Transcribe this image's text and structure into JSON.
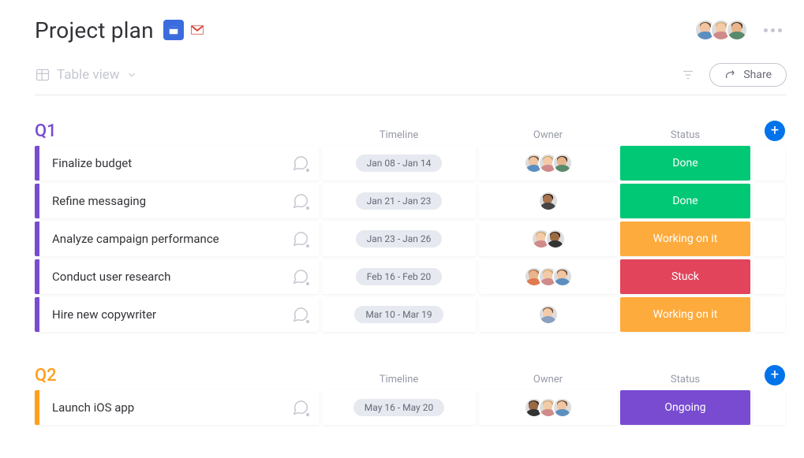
{
  "title": "Project plan",
  "integrations": {
    "items": [
      "google-calendar-icon",
      "gmail-icon"
    ]
  },
  "header_avatars": [
    {
      "skin": "#f1c4a2",
      "hair": "#6a4326",
      "shirt": "#5c8fbf"
    },
    {
      "skin": "#f3cba8",
      "hair": "#caa46b",
      "shirt": "#d08a8a"
    },
    {
      "skin": "#e9b48b",
      "hair": "#3a2a1a",
      "shirt": "#5a8a6c"
    }
  ],
  "view": {
    "label": "Table view"
  },
  "share": {
    "label": "Share"
  },
  "columns": {
    "timeline": "Timeline",
    "owner": "Owner",
    "status": "Status"
  },
  "status_colors": {
    "Done": "#00c875",
    "Working on it": "#fdab3d",
    "Stuck": "#e2445c",
    "Ongoing": "#784bd1"
  },
  "groups": [
    {
      "name": "Q1",
      "color": "#784bd1",
      "rows": [
        {
          "name": "Finalize budget",
          "timeline": "Jan 08 - Jan 14",
          "owners": [
            {
              "skin": "#f1c4a2",
              "hair": "#6a4326",
              "shirt": "#5c8fbf"
            },
            {
              "skin": "#f3cba8",
              "hair": "#caa46b",
              "shirt": "#d08a8a"
            },
            {
              "skin": "#e9b48b",
              "hair": "#3a2a1a",
              "shirt": "#5a8a6c"
            }
          ],
          "status": "Done"
        },
        {
          "name": "Refine messaging",
          "timeline": "Jan 21 - Jan 23",
          "owners": [
            {
              "skin": "#a8734d",
              "hair": "#2a1a10",
              "shirt": "#444"
            }
          ],
          "status": "Done"
        },
        {
          "name": "Analyze campaign performance",
          "timeline": "Jan 23 - Jan 26",
          "owners": [
            {
              "skin": "#f3cba8",
              "hair": "#caa46b",
              "shirt": "#d08a8a"
            },
            {
              "skin": "#9a6a44",
              "hair": "#2a1a10",
              "shirt": "#333"
            }
          ],
          "status": "Working on it"
        },
        {
          "name": "Conduct user research",
          "timeline": "Feb 16 - Feb 20",
          "owners": [
            {
              "skin": "#e9b48b",
              "hair": "#a96a3a",
              "shirt": "#e07a50"
            },
            {
              "skin": "#f3cba8",
              "hair": "#caa46b",
              "shirt": "#d08a8a"
            },
            {
              "skin": "#f1c4a2",
              "hair": "#6a4326",
              "shirt": "#5c8fbf"
            }
          ],
          "status": "Stuck"
        },
        {
          "name": "Hire new copywriter",
          "timeline": "Mar 10 - Mar 19",
          "owners": [
            {
              "skin": "#f3cba8",
              "hair": "#7a4a2a",
              "shirt": "#8aa0c0"
            }
          ],
          "status": "Working on it"
        }
      ]
    },
    {
      "name": "Q2",
      "color": "#ff9f1a",
      "rows": [
        {
          "name": "Launch iOS app",
          "timeline": "May 16 - May 20",
          "owners": [
            {
              "skin": "#9a6a44",
              "hair": "#2a1a10",
              "shirt": "#333"
            },
            {
              "skin": "#f3cba8",
              "hair": "#caa46b",
              "shirt": "#d08a8a"
            },
            {
              "skin": "#f1c4a2",
              "hair": "#6a4326",
              "shirt": "#5c8fbf"
            }
          ],
          "status": "Ongoing"
        }
      ]
    }
  ]
}
